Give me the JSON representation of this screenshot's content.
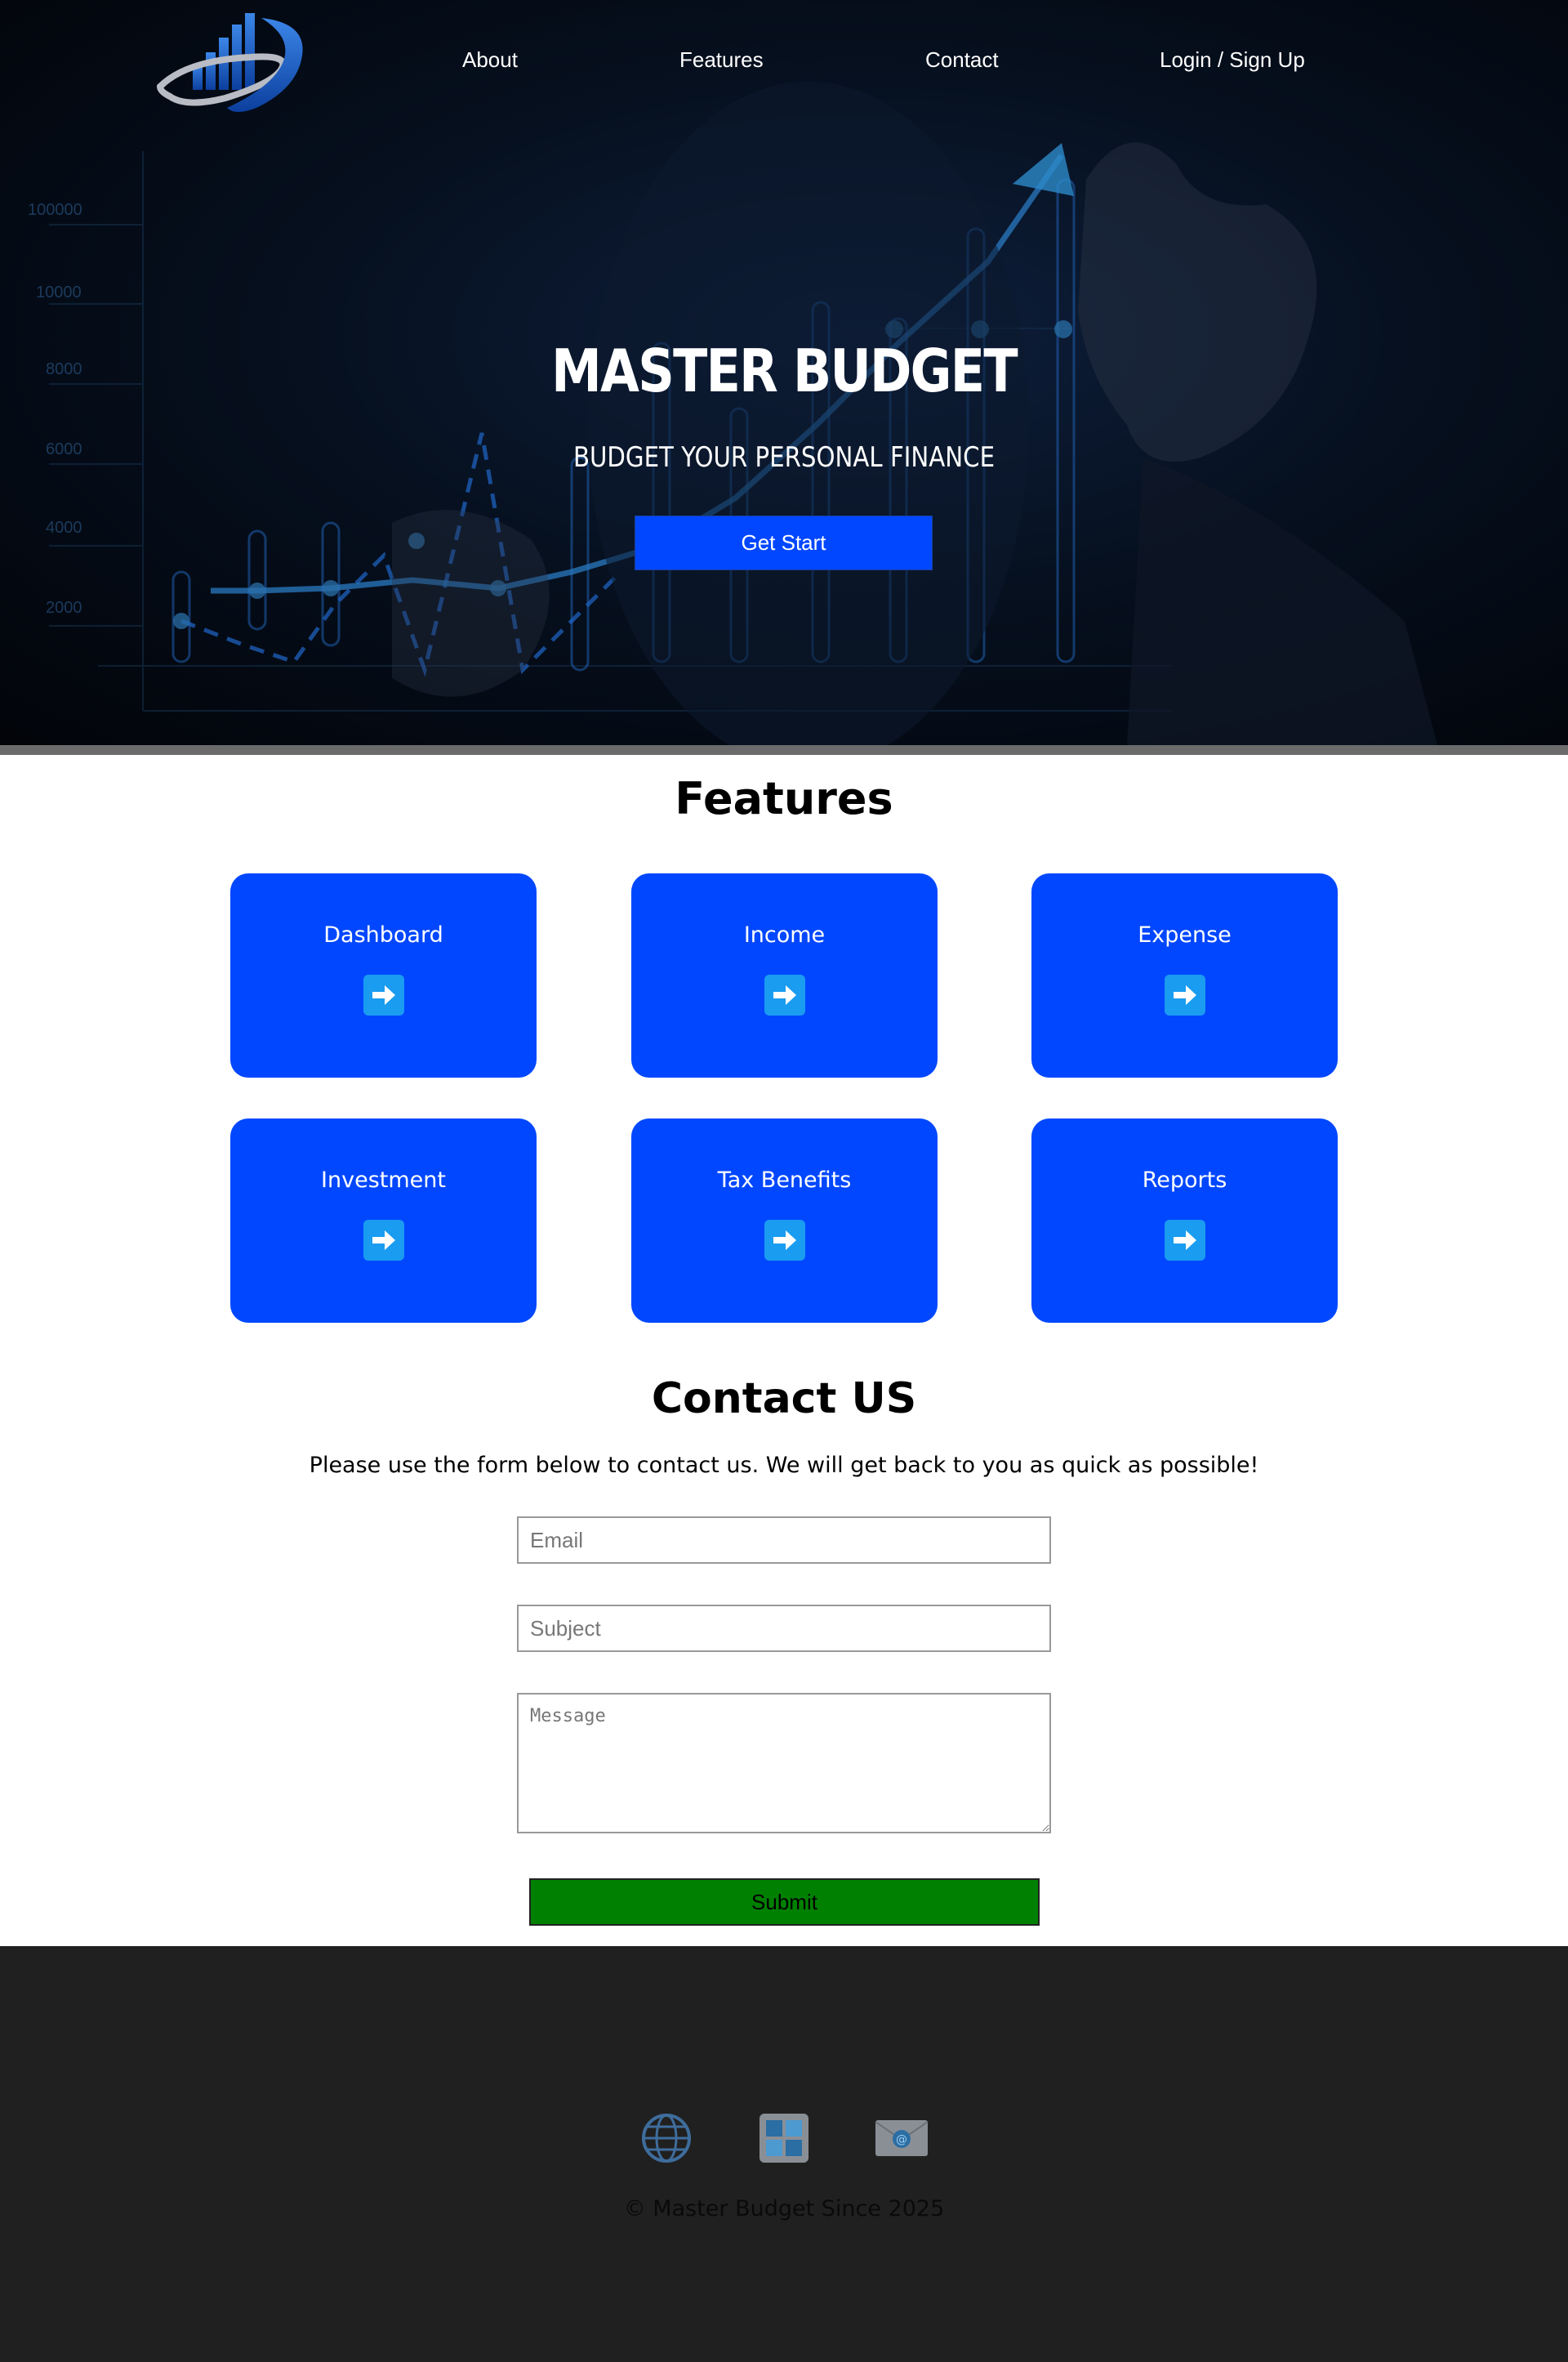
{
  "nav": {
    "about": "About",
    "features": "Features",
    "contact": "Contact",
    "login": "Login / Sign Up"
  },
  "hero": {
    "title": "MASTER BUDGET",
    "subtitle": "BUDGET YOUR PERSONAL FINANCE",
    "cta": "Get Start",
    "chart_axis_labels": [
      "100000",
      "10000",
      "8000",
      "6000",
      "4000",
      "2000"
    ]
  },
  "features": {
    "title": "Features",
    "cards": [
      {
        "label": "Dashboard",
        "icon": "arrow-right-icon"
      },
      {
        "label": "Income",
        "icon": "arrow-right-icon"
      },
      {
        "label": "Expense",
        "icon": "arrow-right-icon"
      },
      {
        "label": "Investment",
        "icon": "arrow-right-icon"
      },
      {
        "label": "Tax Benefits",
        "icon": "arrow-right-icon"
      },
      {
        "label": "Reports",
        "icon": "arrow-right-icon"
      }
    ]
  },
  "contact": {
    "title": "Contact US",
    "description": "Please use the form below to contact us. We will get back to you as quick as possible!",
    "email_placeholder": "Email",
    "subject_placeholder": "Subject",
    "message_placeholder": "Message",
    "submit": "Submit"
  },
  "footer": {
    "icons": [
      "globe-icon",
      "windows-icon",
      "mail-icon"
    ],
    "copyright": "© Master Budget Since 2025"
  },
  "colors": {
    "accent": "#0047ff",
    "submit": "#008000",
    "footer_bg": "#202020",
    "arrow_tile": "#1a9cf0"
  }
}
